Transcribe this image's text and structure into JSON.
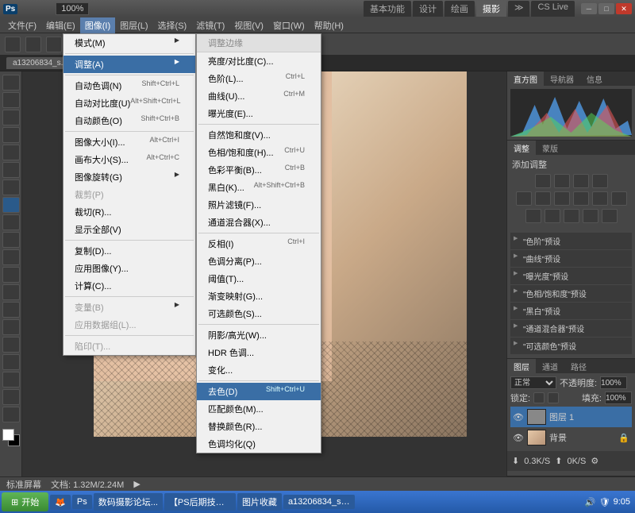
{
  "title": {
    "app": "Ps",
    "workspace_tabs": [
      "基本功能",
      "设计",
      "绘画",
      "摄影"
    ],
    "active_ws": "摄影",
    "cslive": "CS Live"
  },
  "menu": [
    "文件(F)",
    "编辑(E)",
    "图像(I)",
    "图层(L)",
    "选择(S)",
    "滤镜(T)",
    "视图(V)",
    "窗口(W)",
    "帮助(H)"
  ],
  "open_menu_index": 2,
  "doc_tab": "a13206834_s...",
  "zoom_field": "100%",
  "dd1": [
    {
      "t": "模式(M)",
      "arrow": true
    },
    {
      "sep": true
    },
    {
      "t": "调整(A)",
      "arrow": true,
      "hl": true
    },
    {
      "sep": true
    },
    {
      "t": "自动色调(N)",
      "sc": "Shift+Ctrl+L"
    },
    {
      "t": "自动对比度(U)",
      "sc": "Alt+Shift+Ctrl+L"
    },
    {
      "t": "自动颜色(O)",
      "sc": "Shift+Ctrl+B"
    },
    {
      "sep": true
    },
    {
      "t": "图像大小(I)...",
      "sc": "Alt+Ctrl+I"
    },
    {
      "t": "画布大小(S)...",
      "sc": "Alt+Ctrl+C"
    },
    {
      "t": "图像旋转(G)",
      "arrow": true
    },
    {
      "t": "裁剪(P)",
      "dis": true
    },
    {
      "t": "裁切(R)..."
    },
    {
      "t": "显示全部(V)"
    },
    {
      "sep": true
    },
    {
      "t": "复制(D)..."
    },
    {
      "t": "应用图像(Y)..."
    },
    {
      "t": "计算(C)..."
    },
    {
      "sep": true
    },
    {
      "t": "变量(B)",
      "arrow": true,
      "dis": true
    },
    {
      "t": "应用数据组(L)...",
      "dis": true
    },
    {
      "sep": true
    },
    {
      "t": "陷印(T)...",
      "dis": true
    }
  ],
  "dd2_head": "调整边缘",
  "dd2": [
    {
      "t": "亮度/对比度(C)..."
    },
    {
      "t": "色阶(L)...",
      "sc": "Ctrl+L"
    },
    {
      "t": "曲线(U)...",
      "sc": "Ctrl+M"
    },
    {
      "t": "曝光度(E)..."
    },
    {
      "sep": true
    },
    {
      "t": "自然饱和度(V)..."
    },
    {
      "t": "色相/饱和度(H)...",
      "sc": "Ctrl+U"
    },
    {
      "t": "色彩平衡(B)...",
      "sc": "Ctrl+B"
    },
    {
      "t": "黑白(K)...",
      "sc": "Alt+Shift+Ctrl+B"
    },
    {
      "t": "照片滤镜(F)..."
    },
    {
      "t": "通道混合器(X)..."
    },
    {
      "sep": true
    },
    {
      "t": "反相(I)",
      "sc": "Ctrl+I"
    },
    {
      "t": "色调分离(P)..."
    },
    {
      "t": "阈值(T)..."
    },
    {
      "t": "渐变映射(G)..."
    },
    {
      "t": "可选颜色(S)..."
    },
    {
      "sep": true
    },
    {
      "t": "阴影/高光(W)..."
    },
    {
      "t": "HDR 色调..."
    },
    {
      "t": "变化..."
    },
    {
      "sep": true
    },
    {
      "t": "去色(D)",
      "sc": "Shift+Ctrl+U",
      "hl": true
    },
    {
      "t": "匹配颜色(M)..."
    },
    {
      "t": "替换颜色(R)..."
    },
    {
      "t": "色调均化(Q)"
    }
  ],
  "panels": {
    "histo_tabs": [
      "直方图",
      "导航器",
      "信息"
    ],
    "adj_tabs": [
      "调整",
      "蒙版"
    ],
    "adj_title": "添加调整",
    "presets": [
      "\"色阶\"预设",
      "\"曲线\"预设",
      "\"曝光度\"预设",
      "\"色相/饱和度\"预设",
      "\"黑白\"预设",
      "\"通道混合器\"预设",
      "\"可选颜色\"预设"
    ],
    "layers_tabs": [
      "图层",
      "通道",
      "路径"
    ],
    "blend": "正常",
    "opacity_lbl": "不透明度:",
    "opacity": "100%",
    "lock_lbl": "锁定:",
    "fill_lbl": "填充:",
    "fill": "100%",
    "layer1": "图层 1",
    "layer_bg": "背景"
  },
  "status": {
    "zoom": "标准屏幕",
    "doc": "文档: 1.32M/2.24M",
    "net": "0.3K/S",
    "net2": "0K/S"
  },
  "taskbar": {
    "start": "开始",
    "items": [
      "数码摄影论坛...",
      "【PS后期技巧...",
      "图片收藏",
      "a13206834_s.j...",
      ""
    ],
    "time": "9:05"
  }
}
